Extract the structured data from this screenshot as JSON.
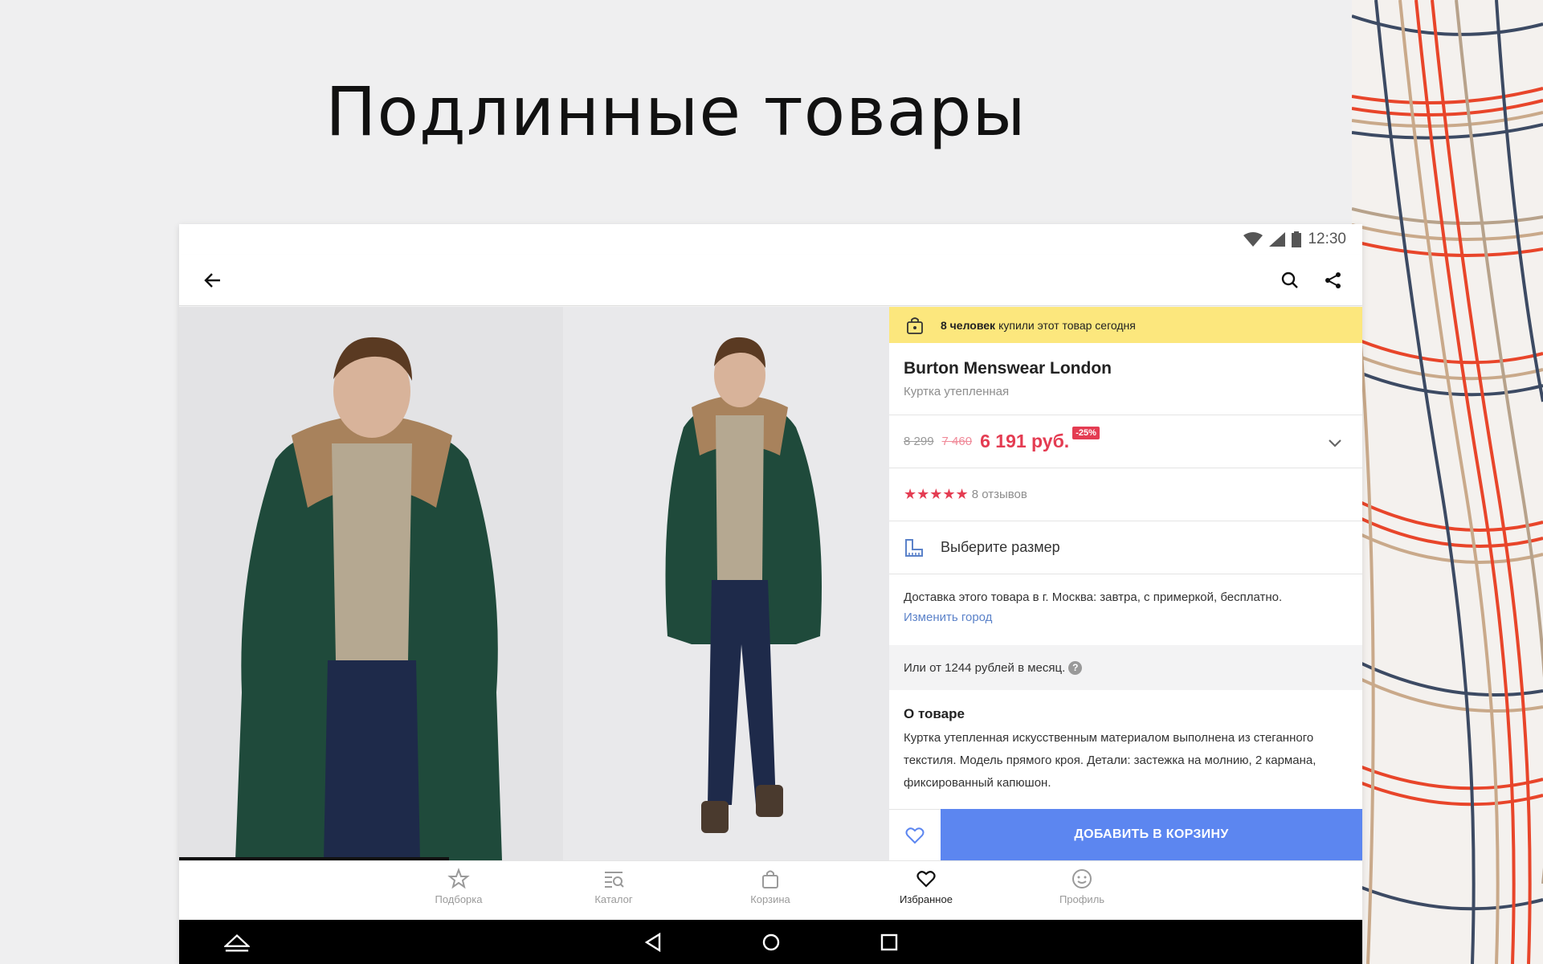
{
  "headline": "Подлинные товары",
  "status_bar": {
    "time": "12:30",
    "icons": [
      "wifi-icon",
      "signal-icon",
      "battery-icon"
    ]
  },
  "toolbar": {
    "icons": [
      "back-arrow-icon",
      "search-icon",
      "share-icon"
    ]
  },
  "product": {
    "buyers_banner": {
      "count": "8 человек",
      "text": "купили этот товар сегодня"
    },
    "brand": "Burton Menswear London",
    "subtitle": "Куртка утепленная",
    "price": {
      "old1": "8 299",
      "old2": "7 460",
      "current": "6 191 руб.",
      "discount": "-25%"
    },
    "rating": {
      "stars": "★★★★★",
      "reviews": "8 отзывов"
    },
    "size_select": "Выберите размер",
    "delivery": {
      "text": "Доставка этого товара в г. Москва: завтра, с примеркой, бесплатно.",
      "change_city": "Изменить город"
    },
    "installment": {
      "text": "Или от 1244 рублей в месяц.",
      "help": "?"
    },
    "about": {
      "title": "О товаре",
      "text": "Куртка утепленная искусственным материалом выполнена из стеганного текстиля. Модель прямого кроя. Детали: застежка на молнию, 2 кармана, фиксированный капюшон."
    },
    "add_to_cart": "ДОБАВИТЬ В КОРЗИНУ"
  },
  "gallery": {
    "progress": 0.38
  },
  "bottom_nav": [
    {
      "label": "Подборка",
      "icon": "star-icon",
      "active": false
    },
    {
      "label": "Каталог",
      "icon": "catalog-icon",
      "active": false
    },
    {
      "label": "Корзина",
      "icon": "bag-icon",
      "active": false
    },
    {
      "label": "Избранное",
      "icon": "heart-icon",
      "active": true
    },
    {
      "label": "Профиль",
      "icon": "smile-icon",
      "active": false
    }
  ],
  "colors": {
    "accent": "#5c86f0",
    "price": "#e43c52",
    "banner": "#fce77d",
    "link": "#5b82c9"
  }
}
